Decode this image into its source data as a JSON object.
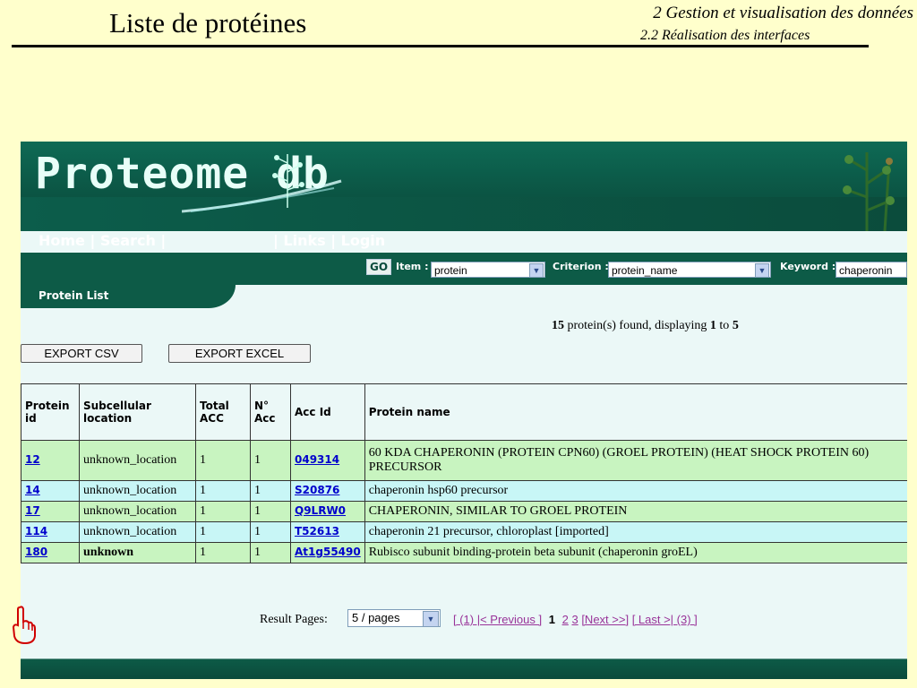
{
  "slide": {
    "title": "Liste de protéines",
    "section": "2 Gestion et visualisation des données",
    "subsection": "2.2 Réalisation des interfaces"
  },
  "app": {
    "logo": "Proteome db",
    "nav_left": "Home | Search |",
    "nav_right": "| Links | Login",
    "go_label": "GO",
    "item_label": "Item :",
    "item_value": "protein",
    "criterion_label": "Criterion :",
    "criterion_value": "protein_name",
    "keyword_label": "Keyword :",
    "keyword_value": "chaperonin",
    "list_tab": "Protein List",
    "summary": {
      "count": "15",
      "found_text": " protein(s) found, displaying ",
      "from": "1",
      "to_text": " to ",
      "to": "5"
    },
    "export_csv": "EXPORT CSV",
    "export_excel": "EXPORT EXCEL",
    "columns": {
      "protein_id": [
        "Protein",
        "id"
      ],
      "location": [
        "Subcellular",
        "location"
      ],
      "total_acc": [
        "Total",
        "ACC"
      ],
      "n_acc": [
        "N°",
        "Acc"
      ],
      "acc_id": "Acc Id",
      "protein_name": "Protein name"
    },
    "rows": [
      {
        "id": "12",
        "location": "unknown_location",
        "total": "1",
        "n": "1",
        "acc": "049314",
        "name": "60 KDA CHAPERONIN (PROTEIN CPN60) (GROEL PROTEIN) (HEAT SHOCK PROTEIN 60) PRECURSOR"
      },
      {
        "id": "14",
        "location": "unknown_location",
        "total": "1",
        "n": "1",
        "acc": "S20876",
        "name": "chaperonin hsp60 precursor"
      },
      {
        "id": "17",
        "location": "unknown_location",
        "total": "1",
        "n": "1",
        "acc": "Q9LRW0",
        "name": "CHAPERONIN, SIMILAR TO GROEL PROTEIN"
      },
      {
        "id": "114",
        "location": "unknown_location",
        "total": "1",
        "n": "1",
        "acc": "T52613",
        "name": "chaperonin 21 precursor, chloroplast [imported]"
      },
      {
        "id": "180",
        "location": "unknown",
        "total": "1",
        "n": "1",
        "acc": "At1g55490",
        "name": "Rubisco subunit binding-protein beta subunit (chaperonin groEL)"
      }
    ],
    "pager": {
      "label": "Result Pages:",
      "page_size": "5 / pages",
      "first_prev": "[ (1) |< Previous ]",
      "current": "1",
      "page2": "2",
      "page3": "3",
      "next": "[Next >>]",
      "last": "[ Last >| (3) ]"
    }
  },
  "colors": {
    "slide_bg": "#ffffcc",
    "banner_green": "#0d5b47",
    "row_green": "#c8f4c0",
    "row_blue": "#c8f6f6",
    "link_blue": "#0000cc"
  },
  "icons": {
    "pointer": "pointing-hand-icon"
  }
}
